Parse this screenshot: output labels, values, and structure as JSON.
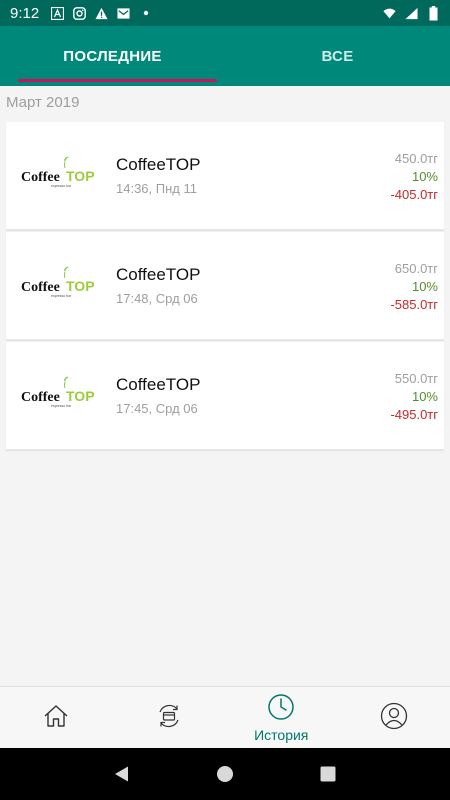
{
  "status_bar": {
    "time": "9:12",
    "icons": [
      "text-a-icon",
      "instagram-icon",
      "warning-icon",
      "mail-icon",
      "dot-icon"
    ],
    "right_icons": [
      "wifi-icon",
      "signal-icon",
      "battery-icon"
    ]
  },
  "tabs": [
    {
      "label": "ПОСЛЕДНИЕ",
      "active": true
    },
    {
      "label": "ВСЕ",
      "active": false
    }
  ],
  "section": {
    "label": "Март 2019"
  },
  "transactions": [
    {
      "merchant": "CoffeeTOP",
      "datetime": "14:36, Пнд 11",
      "total": "450.0тг",
      "discount": "10%",
      "final": "-405.0тг"
    },
    {
      "merchant": "CoffeeTOP",
      "datetime": "17:48, Срд 06",
      "total": "650.0тг",
      "discount": "10%",
      "final": "-585.0тг"
    },
    {
      "merchant": "CoffeeTOP",
      "datetime": "17:45, Срд 06",
      "total": "550.0тг",
      "discount": "10%",
      "final": "-495.0тг"
    }
  ],
  "logo": {
    "text_dark": "Coffee",
    "text_green": "TOP",
    "tagline": "espresso bar"
  },
  "bottom_nav": [
    {
      "icon": "home-icon",
      "label": ""
    },
    {
      "icon": "card-exchange-icon",
      "label": ""
    },
    {
      "icon": "clock-icon",
      "label": "История"
    },
    {
      "icon": "profile-icon",
      "label": ""
    }
  ],
  "colors": {
    "primary": "#00897b",
    "primary_dark": "#00695c",
    "tab_indicator": "#c2185b",
    "discount": "#558b2f",
    "final": "#c62828",
    "muted": "#9e9e9e"
  }
}
